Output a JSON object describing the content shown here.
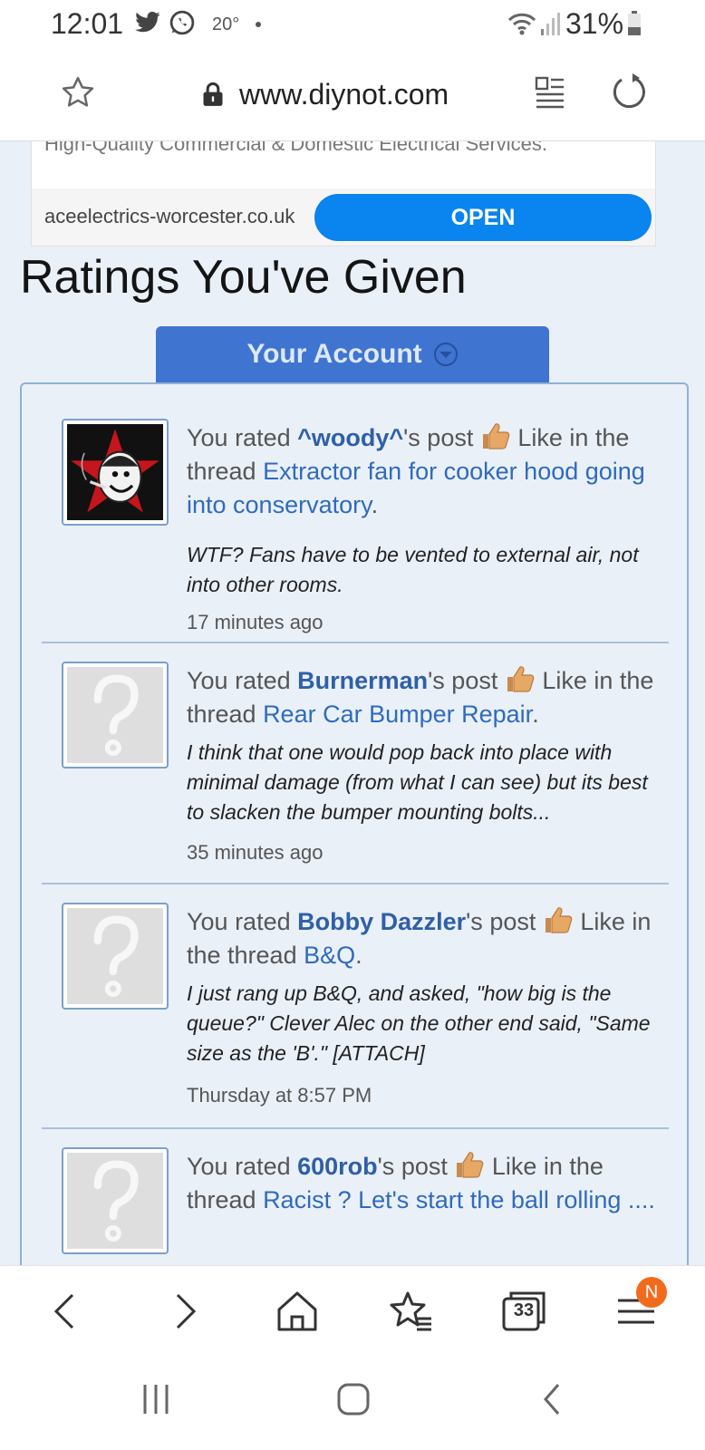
{
  "status_bar": {
    "time": "12:01",
    "temperature": "20°",
    "battery": "31%",
    "icons": [
      "twitter-icon",
      "whatsapp-icon",
      "wifi-icon",
      "signal-icon",
      "battery-icon"
    ]
  },
  "browser": {
    "url": "www.diynot.com",
    "icons": [
      "bookmark-star-icon",
      "lock-icon",
      "reader-mode-icon",
      "reload-icon"
    ]
  },
  "ad": {
    "tagline": "High-Quality Commercial & Domestic Electrical Services.",
    "domain": "aceelectrics-worcester.co.uk",
    "cta": "OPEN",
    "cta_color": "#0a84ee"
  },
  "page": {
    "title": "Ratings You've Given",
    "account_tab": "Your Account",
    "accent": "#3f74d1"
  },
  "ratings": [
    {
      "prefix": "You rated ",
      "user": "^woody^",
      "mid": "'s post ",
      "reaction": " Like in the thread ",
      "thread": "Extractor fan for cooker hood going into conservatory",
      "suffix": ".",
      "snippet": "WTF? Fans have to be vented to external air, not into other rooms.",
      "time": "17 minutes ago",
      "avatar": "custom-avatar"
    },
    {
      "prefix": "You rated ",
      "user": "Burnerman",
      "mid": "'s post ",
      "reaction": " Like in the thread ",
      "thread": "Rear Car Bumper Repair",
      "suffix": ".",
      "snippet": "I think that one would pop back into place with minimal damage (from what I can see) but its best to slacken the bumper mounting bolts...",
      "time": "35 minutes ago",
      "avatar": "default-avatar"
    },
    {
      "prefix": "You rated ",
      "user": "Bobby Dazzler",
      "mid": "'s post ",
      "reaction": " Like in the thread ",
      "thread": "B&Q",
      "suffix": ".",
      "snippet": "I just rang up B&Q, and asked, \"how big is the queue?\" Clever Alec on the other end said, \"Same size as the 'B'.\" [ATTACH]",
      "time": "Thursday at 8:57 PM",
      "avatar": "default-avatar"
    },
    {
      "prefix": "You rated ",
      "user": "600rob",
      "mid": "'s post ",
      "reaction": " Like in the thread ",
      "thread": "Racist ? Let's start the ball rolling ....",
      "suffix": "",
      "snippet": "",
      "time": "",
      "avatar": "default-avatar"
    }
  ],
  "bottom_nav": {
    "tabs_count": "33",
    "menu_badge": "N",
    "icons": [
      "back-icon",
      "forward-icon",
      "home-icon",
      "bookmarks-icon",
      "tabs-icon",
      "menu-icon"
    ]
  },
  "system_nav": {
    "icons": [
      "recents-icon",
      "home-icon",
      "back-icon"
    ]
  }
}
